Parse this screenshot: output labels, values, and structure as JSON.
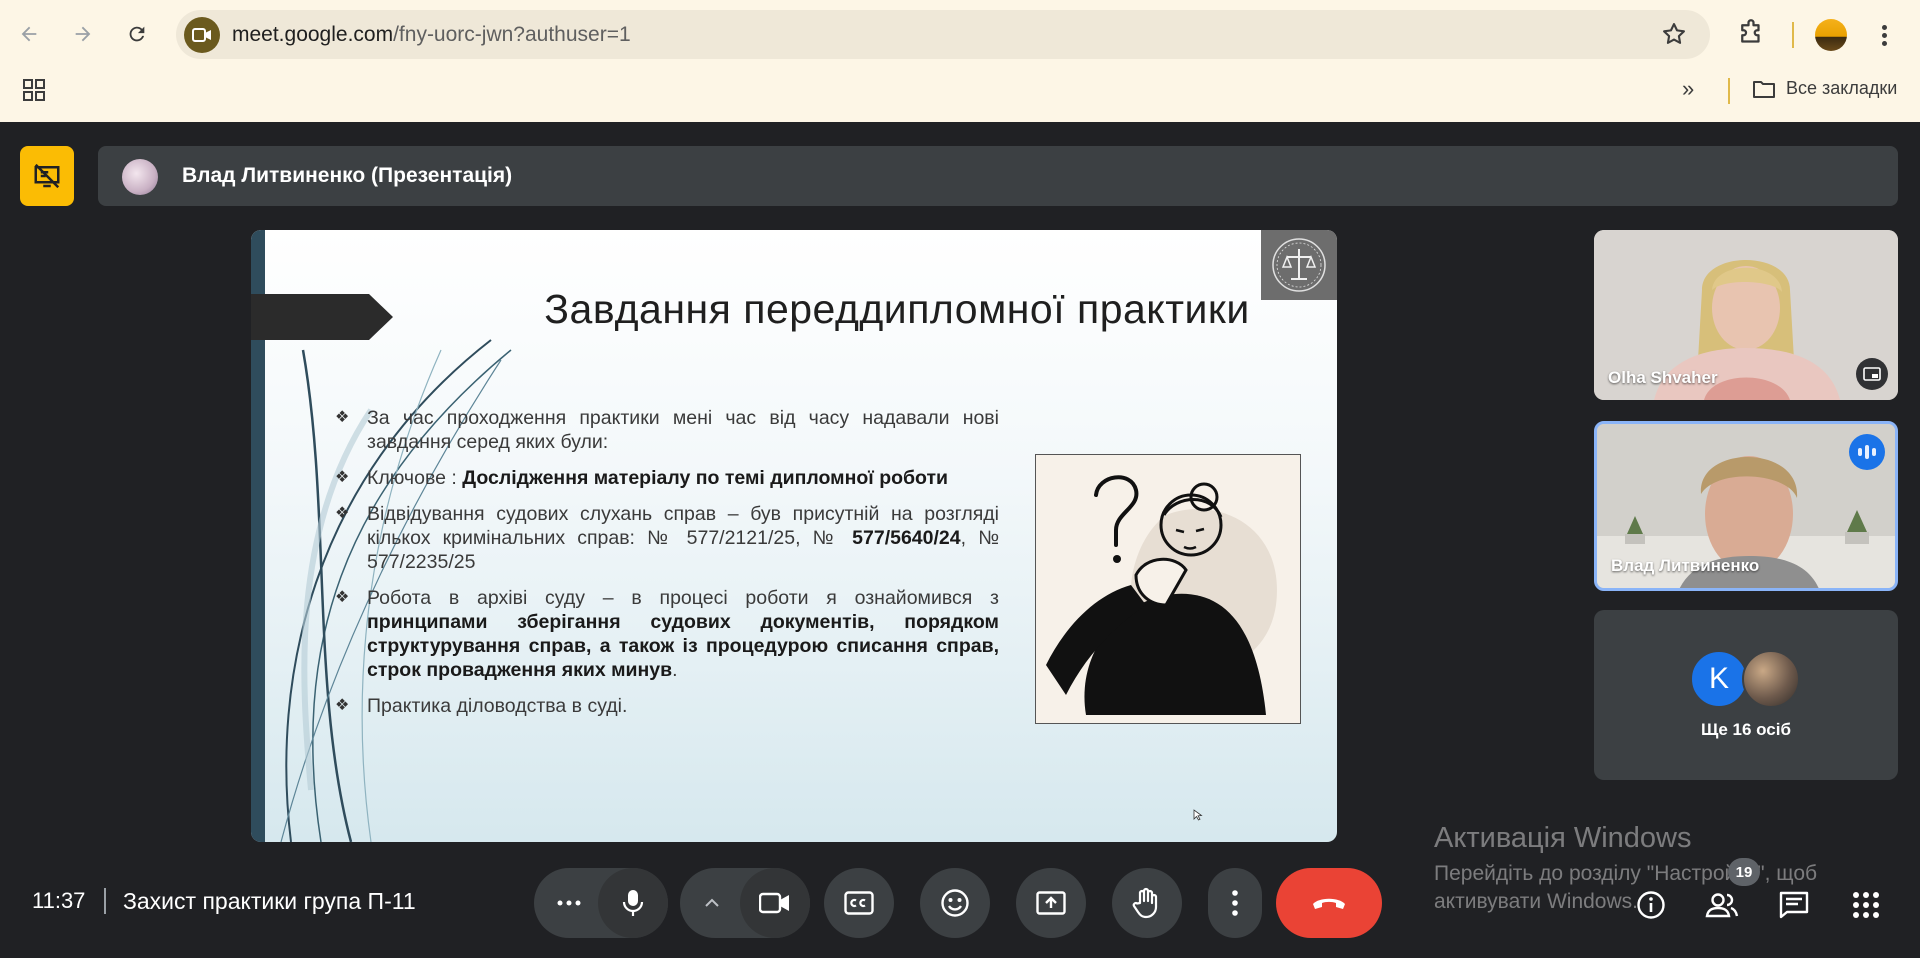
{
  "browser": {
    "url_host": "meet.google.com",
    "url_path": "/fny-uorc-jwn?authuser=1",
    "bookmarks_label": "Все закладки"
  },
  "presentation": {
    "presenter_label": "Влад Литвиненко (Презентація)"
  },
  "slide": {
    "title": "Завдання переддипломної практики",
    "bullets": [
      {
        "pre": "За час проходження практики мені час від часу надавали нові завдання серед яких були:",
        "bold": "",
        "post": ""
      },
      {
        "pre": "Ключове : ",
        "bold": "Дослідження матеріалу по темі дипломної роботи",
        "post": ""
      },
      {
        "pre": "Відвідування судових слухань справ – був присутній на розгляді кількох кримінальних справ: № 577/2121/25, № ",
        "bold": "577/5640/24",
        "post": ", № 577/2235/25"
      },
      {
        "pre": "Робота в архіві суду – в процесі роботи я ознайомився з ",
        "bold": "принципами зберігання судових документів, порядком структурування справ, а також із процедурою списання справ, строк провадження яких минув",
        "post": "."
      },
      {
        "pre": "Практика діловодства в суді.",
        "bold": "",
        "post": ""
      }
    ]
  },
  "participants": {
    "tile1_name": "Olha Shvaher",
    "tile2_name": "Влад Литвиненко",
    "avatar_initial": "K",
    "others_label": "Ще 16 осіб",
    "people_count": "19"
  },
  "meeting": {
    "time": "11:37",
    "title": "Захист практики група П-11"
  },
  "watermark": {
    "title": "Активація Windows",
    "subtitle": "Перейдіть до розділу \"Настройки\", щоб активувати Windows."
  },
  "colors": {
    "accent_yellow": "#fbbc04",
    "hangup_red": "#ea4335",
    "meet_bg": "#202124",
    "speaking_blue": "#1a73e8"
  }
}
